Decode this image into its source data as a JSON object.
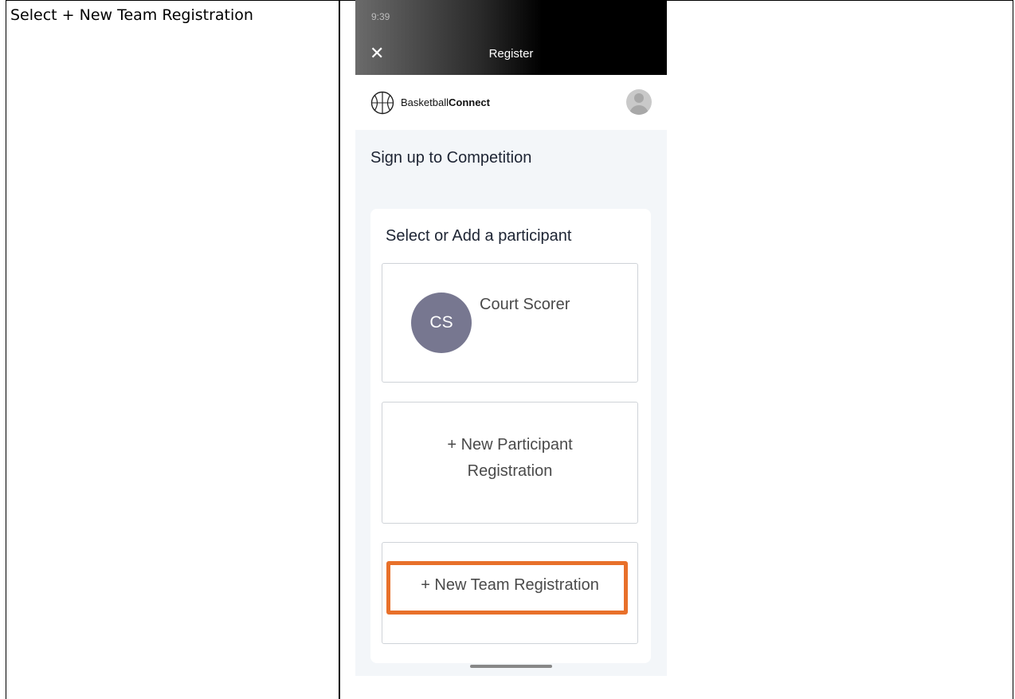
{
  "instruction": "Select + New Team Registration",
  "phone": {
    "status_time": "9:39 ",
    "nav": {
      "close_symbol": "✕",
      "title": "Register"
    },
    "app": {
      "logo_text_regular": "Basketball",
      "logo_text_bold": "Connect"
    },
    "page_title": "Sign up to Competition",
    "card": {
      "title": "Select or Add a participant",
      "participant": {
        "initials": "CS",
        "name": "Court Scorer"
      },
      "new_participant_line1": "+ New Participant",
      "new_participant_line2": "Registration",
      "new_team": "+ New Team Registration"
    }
  },
  "colors": {
    "highlight": "#e8702a",
    "avatar_bg": "#777790",
    "page_bg": "#f3f6f9"
  }
}
